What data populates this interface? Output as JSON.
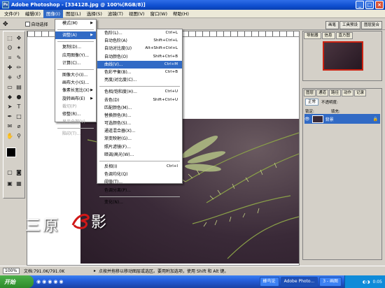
{
  "title_bar": {
    "title": "Adobe Photoshop - [334128.jpg @ 100%(RGB/8)]"
  },
  "menubar": [
    "文件(F)",
    "编辑(E)",
    "图像(I)",
    "图层(L)",
    "选择(S)",
    "滤镜(T)",
    "视图(V)",
    "窗口(W)",
    "帮助(H)"
  ],
  "options": {
    "auto_select": "自动选择"
  },
  "palette_tabs": [
    "画笔",
    "工具预设",
    "图层复合"
  ],
  "figure_label": "4.",
  "watermark": "三原",
  "watermark_tail": "影",
  "image_menu": [
    {
      "label": "模式(M)",
      "sub": true
    },
    {
      "sep": true
    },
    {
      "label": "调整(A)",
      "sub": true,
      "hl": true
    },
    {
      "sep": true
    },
    {
      "label": "复制(D)..."
    },
    {
      "label": "应用图像(Y)..."
    },
    {
      "label": "计算(C)..."
    },
    {
      "sep": true
    },
    {
      "label": "图像大小(I)..."
    },
    {
      "label": "画布大小(S)..."
    },
    {
      "label": "像素长宽比(X)",
      "sub": true
    },
    {
      "label": "旋转画布(E)",
      "sub": true
    },
    {
      "label": "裁切(P)",
      "dis": true
    },
    {
      "label": "修整(R)..."
    },
    {
      "label": "显示全部(V)",
      "dis": true
    },
    {
      "sep": true
    },
    {
      "label": "陷印(T)...",
      "dis": true
    }
  ],
  "adjust_menu": [
    {
      "label": "色阶(L)...",
      "sc": "Ctrl+L"
    },
    {
      "label": "自动色阶(A)",
      "sc": "Shift+Ctrl+L"
    },
    {
      "label": "自动对比度(U)",
      "sc": "Alt+Shift+Ctrl+L"
    },
    {
      "label": "自动颜色(O)",
      "sc": "Shift+Ctrl+B"
    },
    {
      "label": "曲线(V)...",
      "sc": "Ctrl+M",
      "hl": true
    },
    {
      "label": "色彩平衡(B)...",
      "sc": "Ctrl+B"
    },
    {
      "label": "亮度/对比度(C)..."
    },
    {
      "sep": true
    },
    {
      "label": "色相/饱和度(H)...",
      "sc": "Ctrl+U"
    },
    {
      "label": "去色(D)",
      "sc": "Shift+Ctrl+U"
    },
    {
      "label": "匹配颜色(M)..."
    },
    {
      "label": "替换颜色(R)..."
    },
    {
      "label": "可选颜色(S)..."
    },
    {
      "label": "通道混合器(X)..."
    },
    {
      "label": "渐变映射(G)..."
    },
    {
      "label": "照片滤镜(F)..."
    },
    {
      "label": "暗调/高光(W)..."
    },
    {
      "sep": true
    },
    {
      "label": "反相(I)",
      "sc": "Ctrl+I"
    },
    {
      "label": "色调均化(Q)"
    },
    {
      "label": "阈值(T)..."
    },
    {
      "label": "色调分离(P)..."
    },
    {
      "sep": true
    },
    {
      "label": "变化(N)..."
    }
  ],
  "navigator_tabs": [
    "导航器",
    "信息",
    "直方图"
  ],
  "layers": {
    "tabs": [
      "图层",
      "通道",
      "路径",
      "动作",
      "记录"
    ],
    "blend_mode": "正常",
    "opacity_label": "不透明度:",
    "lock_label": "锁定:",
    "fill_label": "填充:",
    "layer_name": "背景"
  },
  "status": {
    "zoom": "100%",
    "doc": "文档:791.0K/791.0K",
    "hint": "点按并拖移以移动图层或选区。要用附加选项，使用 Shift 和 Alt 键。"
  },
  "taskbar": {
    "start": "开始",
    "items": [
      "蜂鸟论",
      "Adobe Photo...",
      "3 - 画图"
    ],
    "clock": "0:05"
  }
}
